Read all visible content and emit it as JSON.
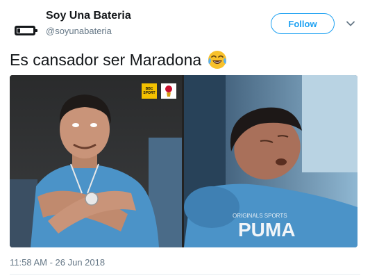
{
  "author": {
    "display_name": "Soy Una Bateria",
    "handle": "@soyunabateria",
    "avatar_icon": "battery-icon"
  },
  "follow_button": {
    "label": "Follow"
  },
  "menu": {
    "icon": "chevron-down-icon"
  },
  "tweet": {
    "text": "Es cansador ser Maradona",
    "emoji": "face-with-tears-of-joy-emoji"
  },
  "media": {
    "left_photo": {
      "overlay_logos": [
        "bbc-sport-logo",
        "world-cup-2018-logo"
      ],
      "bbc_line1": "BBC",
      "bbc_line2": "SPORT"
    },
    "right_photo": {
      "shirt_text_top": "ORIGINALS SPORTS",
      "shirt_text_main": "PUMA"
    }
  },
  "timestamp": "11:58 AM - 26 Jun 2018",
  "colors": {
    "accent": "#1da1f2",
    "text_primary": "#14171a",
    "text_secondary": "#657786",
    "divider": "#e6ecf0"
  }
}
